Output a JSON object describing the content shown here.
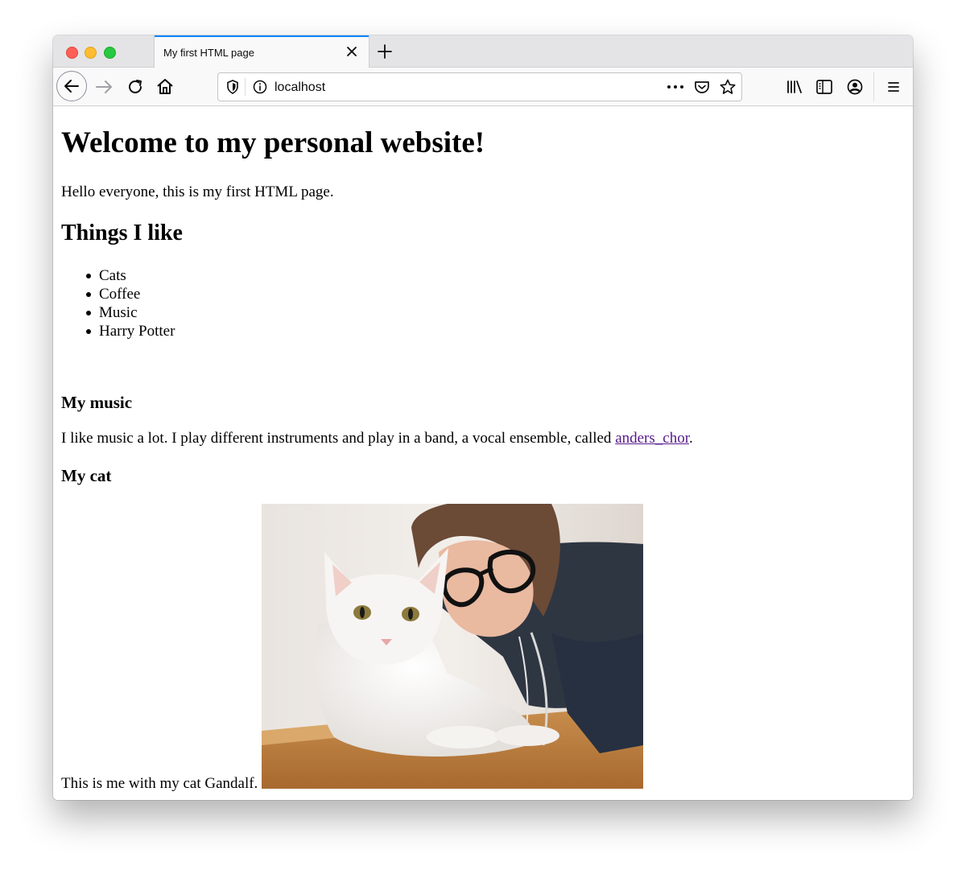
{
  "browser": {
    "tab_title": "My first HTML page",
    "url": "localhost",
    "icons": [
      "back-icon",
      "forward-icon",
      "reload-icon",
      "home-icon",
      "shield-icon",
      "info-icon",
      "more-icon",
      "pocket-icon",
      "star-icon",
      "library-icon",
      "sidebar-icon",
      "account-icon",
      "menu-icon",
      "close-icon",
      "plus-icon"
    ]
  },
  "page": {
    "heading": "Welcome to my personal website!",
    "intro": "Hello everyone, this is my first HTML page.",
    "likes_heading": "Things I like",
    "likes": [
      "Cats",
      "Coffee",
      "Music",
      "Harry Potter"
    ],
    "music_heading": "My music",
    "music_text_before": "I like music a lot. I play different instruments and play in a band, a vocal ensemble, called ",
    "music_link": "anders_chor",
    "music_text_after": ".",
    "cat_heading": "My cat",
    "cat_caption": "This is me with my cat Gandalf.",
    "link_color": "#551a8b"
  }
}
